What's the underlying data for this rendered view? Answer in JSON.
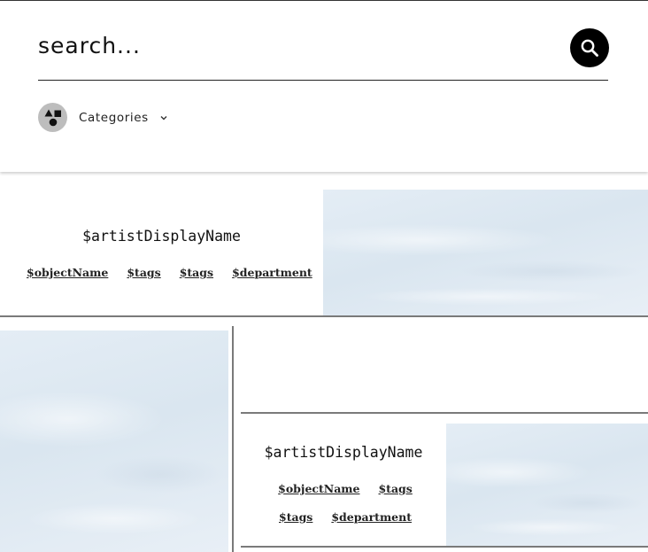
{
  "search": {
    "placeholder": "search...",
    "value": ""
  },
  "filters": {
    "categories_label": "Categories"
  },
  "icons": {
    "search": "search-icon",
    "categories": "shapes-icon",
    "dropdown": "chevron-down-icon"
  },
  "colors": {
    "accent": "#000000",
    "divider": "#7a7a7a",
    "image_placeholder": "#dde8f1"
  },
  "cards": [
    {
      "artist": "$artistDisplayName",
      "object_name": "$objectName",
      "tags": [
        "$tags",
        "$tags"
      ],
      "department": "$department"
    },
    {
      "artist": "$artistDisplayName",
      "object_name": "$objectName",
      "tags": [
        "$tags",
        "$tags"
      ],
      "department": "$department"
    }
  ]
}
